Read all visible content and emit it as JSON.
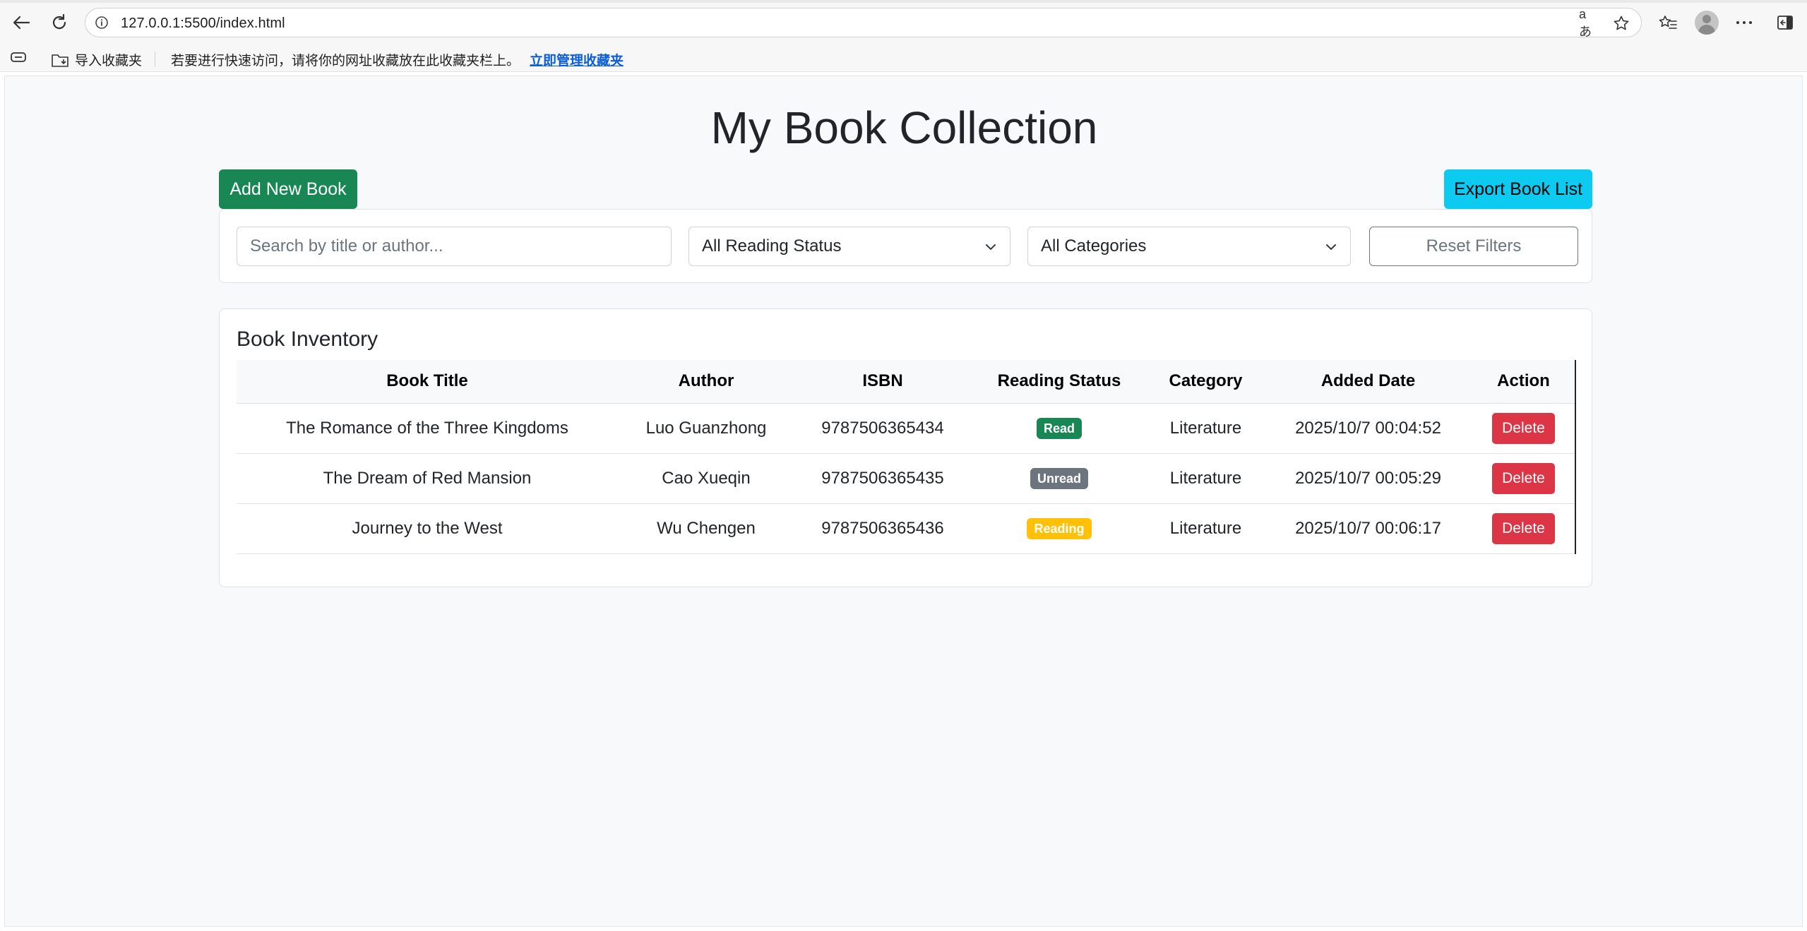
{
  "browser": {
    "url": "127.0.0.1:5500/index.html",
    "bookmarks": {
      "import_label": "导入收藏夹",
      "hint_text": "若要进行快速访问，请将你的网址收藏放在此收藏夹栏上。",
      "manage_link": "立即管理收藏夹"
    },
    "read_aloud_label": "aあ"
  },
  "page": {
    "title": "My Book Collection",
    "add_button": "Add New Book",
    "export_button": "Export Book List"
  },
  "filters": {
    "search_placeholder": "Search by title or author...",
    "status_selected": "All Reading Status",
    "category_selected": "All Categories",
    "reset_button": "Reset Filters"
  },
  "inventory": {
    "title": "Book Inventory",
    "columns": [
      "Book Title",
      "Author",
      "ISBN",
      "Reading Status",
      "Category",
      "Added Date",
      "Action"
    ],
    "rows": [
      {
        "title": "The Romance of the Three Kingdoms",
        "author": "Luo Guanzhong",
        "isbn": "9787506365434",
        "status": "Read",
        "category": "Literature",
        "added": "2025/10/7 00:04:52",
        "action": "Delete"
      },
      {
        "title": "The Dream of Red Mansion",
        "author": "Cao Xueqin",
        "isbn": "9787506365435",
        "status": "Unread",
        "category": "Literature",
        "added": "2025/10/7 00:05:29",
        "action": "Delete"
      },
      {
        "title": "Journey to the West",
        "author": "Wu Chengen",
        "isbn": "9787506365436",
        "status": "Reading",
        "category": "Literature",
        "added": "2025/10/7 00:06:17",
        "action": "Delete"
      }
    ]
  },
  "colors": {
    "add_button": "#198754",
    "export_button": "#0dcaf0",
    "delete_button": "#dc3545",
    "badge_read": "#198754",
    "badge_unread": "#6c757d",
    "badge_reading": "#ffc107"
  }
}
